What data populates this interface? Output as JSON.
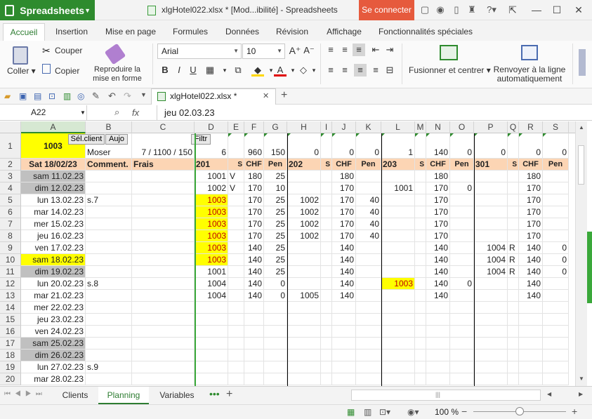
{
  "app": {
    "name": "Spreadsheets",
    "doc_title": "xlgHotel022.xlsx * [Mod...ibilité] - Spreadsheets",
    "connect_label": "Se connecter"
  },
  "tabs": [
    "Accueil",
    "Insertion",
    "Mise en page",
    "Formules",
    "Données",
    "Révision",
    "Affichage",
    "Fonctionnalités spéciales"
  ],
  "ribbon": {
    "paste": "Coller",
    "cut": "Couper",
    "copy": "Copier",
    "format_painter": "Reproduire la mise en forme",
    "font": "Arial",
    "size": "10",
    "bold": "B",
    "italic": "I",
    "underline": "U",
    "merge": "Fusionner et centrer",
    "wrap": "Renvoyer à la ligne automatiquement"
  },
  "file_tab": "xlgHotel022.xlsx *",
  "formula_bar": {
    "cell_ref": "A22",
    "fx": "fx",
    "content": "jeu 02.03.23"
  },
  "columns": [
    "A",
    "B",
    "C",
    "D",
    "E",
    "F",
    "G",
    "H",
    "I",
    "J",
    "K",
    "L",
    "M",
    "N",
    "O",
    "P",
    "Q",
    "R",
    "S"
  ],
  "rows": [
    "1",
    "2",
    "3",
    "4",
    "5",
    "6",
    "7",
    "8",
    "9",
    "10",
    "11",
    "12",
    "13",
    "14",
    "15",
    "16",
    "17",
    "18",
    "19",
    "20"
  ],
  "buttons": {
    "sel_client": "Sél.client",
    "aujo": "Aujo",
    "filtr": "Filtr"
  },
  "row1": {
    "a": "1003",
    "b": "Moser",
    "c": "7 / 1100 / 150",
    "d": "6",
    "f": "960",
    "g": "150",
    "h": "0",
    "j": "0",
    "k": "0",
    "l": "1",
    "n": "140",
    "o": "0",
    "p": "0",
    "r": "0",
    "s": "0"
  },
  "row2": {
    "a": "Sat 18/02/23",
    "b": "Comment.",
    "c": "Frais",
    "d": "201",
    "e": "S",
    "f": "CHF",
    "g": "Pen",
    "h": "202",
    "i": "S",
    "j": "CHF",
    "k": "Pen",
    "l": "203",
    "m": "S",
    "n": "CHF",
    "o": "Pen",
    "p": "301",
    "q": "S",
    "r": "CHF",
    "s": "Pen"
  },
  "data_rows": [
    {
      "a": "sam 11.02.23",
      "d": "1001",
      "e": "V",
      "f": "180",
      "g": "25",
      "j": "180",
      "n": "180",
      "r": "180"
    },
    {
      "a": "dim 12.02.23",
      "d": "1002",
      "e": "V",
      "f": "170",
      "g": "10",
      "j": "170",
      "l": "1001",
      "n": "170",
      "o": "0",
      "r": "170"
    },
    {
      "a": "lun 13.02.23",
      "b": "s.7",
      "d": "1003",
      "f": "170",
      "g": "25",
      "h": "1002",
      "j": "170",
      "k": "40",
      "n": "170",
      "r": "170"
    },
    {
      "a": "mar 14.02.23",
      "d": "1003",
      "f": "170",
      "g": "25",
      "h": "1002",
      "j": "170",
      "k": "40",
      "n": "170",
      "r": "170"
    },
    {
      "a": "mer 15.02.23",
      "d": "1003",
      "f": "170",
      "g": "25",
      "h": "1002",
      "j": "170",
      "k": "40",
      "n": "170",
      "r": "170"
    },
    {
      "a": "jeu 16.02.23",
      "d": "1003",
      "f": "170",
      "g": "25",
      "h": "1002",
      "j": "170",
      "k": "40",
      "n": "170",
      "r": "170"
    },
    {
      "a": "ven 17.02.23",
      "d": "1003",
      "f": "140",
      "g": "25",
      "j": "140",
      "n": "140",
      "p": "1004",
      "q": "R",
      "r": "140",
      "s": "0"
    },
    {
      "a": "sam 18.02.23",
      "d": "1003",
      "f": "140",
      "g": "25",
      "j": "140",
      "n": "140",
      "p": "1004",
      "q": "R",
      "r": "140",
      "s": "0"
    },
    {
      "a": "dim 19.02.23",
      "d": "1001",
      "f": "140",
      "g": "25",
      "j": "140",
      "n": "140",
      "p": "1004",
      "q": "R",
      "r": "140",
      "s": "0"
    },
    {
      "a": "lun 20.02.23",
      "b": "s.8",
      "d": "1004",
      "f": "140",
      "g": "0",
      "j": "140",
      "l": "1003",
      "n": "140",
      "o": "0",
      "r": "140"
    },
    {
      "a": "mar 21.02.23",
      "d": "1004",
      "f": "140",
      "g": "0",
      "h": "1005",
      "j": "140",
      "n": "140",
      "r": "140"
    },
    {
      "a": "mer 22.02.23"
    },
    {
      "a": "jeu 23.02.23"
    },
    {
      "a": "ven 24.02.23"
    },
    {
      "a": "sam 25.02.23"
    },
    {
      "a": "dim 26.02.23"
    },
    {
      "a": "lun 27.02.23",
      "b": "s.9"
    },
    {
      "a": "mar 28.02.23"
    }
  ],
  "sheets": [
    "Clients",
    "Planning",
    "Variables"
  ],
  "zoom": "100 %",
  "colors": {
    "accent": "#2e8b2e",
    "yellow": "#ffff00",
    "gray": "#c0c0c0",
    "orange": "#fcd5b4",
    "red_text": "#c00000"
  }
}
